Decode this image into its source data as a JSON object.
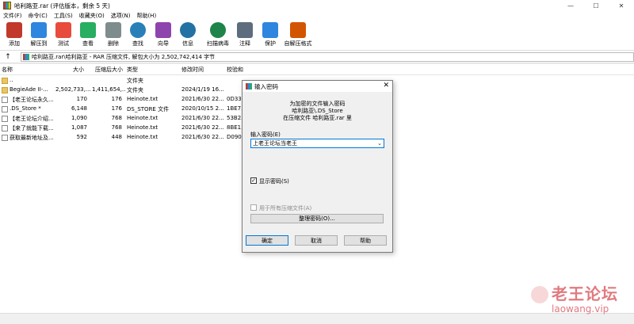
{
  "window": {
    "title": "哈利路亚.rar (评估版本，剩余 5 天)",
    "controls": [
      "—",
      "☐",
      "✕"
    ]
  },
  "menu": [
    "文件(F)",
    "命令(C)",
    "工具(S)",
    "收藏夹(O)",
    "选项(N)",
    "帮助(H)"
  ],
  "toolbar": [
    {
      "label": "添加",
      "icon": "add-archive-icon",
      "color": "#c0392b"
    },
    {
      "label": "解压到",
      "icon": "extract-to-icon",
      "color": "#2e86de"
    },
    {
      "label": "测试",
      "icon": "test-icon",
      "color": "#e74c3c"
    },
    {
      "label": "查看",
      "icon": "view-icon",
      "color": "#27ae60"
    },
    {
      "label": "删除",
      "icon": "delete-icon",
      "color": "#7f8c8d"
    },
    {
      "label": "查找",
      "icon": "find-icon",
      "color": "#2980b9"
    },
    {
      "label": "向导",
      "icon": "wizard-icon",
      "color": "#8e44ad"
    },
    {
      "label": "信息",
      "icon": "info-icon",
      "color": "#2471a3"
    },
    {
      "label": "扫描病毒",
      "icon": "virus-scan-icon",
      "color": "#1e8449"
    },
    {
      "label": "注释",
      "icon": "comment-icon",
      "color": "#5d6d7e"
    },
    {
      "label": "保护",
      "icon": "protect-icon",
      "color": "#2e86de"
    },
    {
      "label": "自解压格式",
      "icon": "sfx-icon",
      "color": "#d35400"
    }
  ],
  "address": {
    "up_glyph": "↑",
    "path": "哈利路亚.rar\\哈利路亚 - RAR 压缩文件, 解包大小为 2,502,742,414 字节"
  },
  "columns": [
    "名称",
    "大小",
    "压缩后大小",
    "类型",
    "修改时间",
    "校验和"
  ],
  "files": [
    {
      "name": "..",
      "size": "",
      "packed": "",
      "type": "文件夹",
      "modified": "",
      "crc": "",
      "kind": "folder"
    },
    {
      "name": "BegieAde II-...",
      "size": "2,502,733,...",
      "packed": "1,411,654,...",
      "type": "文件夹",
      "modified": "2024/1/19 16...",
      "crc": "",
      "kind": "folder"
    },
    {
      "name": "【老王论坛永久...",
      "size": "170",
      "packed": "176",
      "type": "Heinote.txt",
      "modified": "2021/6/30 22...",
      "crc": "0D33...",
      "kind": "txt"
    },
    {
      "name": ".DS_Store *",
      "size": "6,148",
      "packed": "176",
      "type": "DS_STORE 文件",
      "modified": "2020/10/15 2...",
      "crc": "1BE7...",
      "kind": "txt"
    },
    {
      "name": "【老王论坛介绍...",
      "size": "1,090",
      "packed": "768",
      "type": "Heinote.txt",
      "modified": "2021/6/30 22...",
      "crc": "53B2...",
      "kind": "txt"
    },
    {
      "name": "【来了就能下载...",
      "size": "1,087",
      "packed": "768",
      "type": "Heinote.txt",
      "modified": "2021/6/30 22...",
      "crc": "8BE1...",
      "kind": "txt"
    },
    {
      "name": "获取最新地址及...",
      "size": "592",
      "packed": "448",
      "type": "Heinote.txt",
      "modified": "2021/6/30 22...",
      "crc": "D090...",
      "kind": "txt"
    }
  ],
  "dialog": {
    "title": "输入密码",
    "close_glyph": "✕",
    "line1": "为加密的文件输入密码",
    "line2": "哈利路亚\\.DS_Store",
    "line3": "在压缩文件 哈利路亚.rar 里",
    "password_label": "输入密码(E)",
    "password_value": "上老王论坛当老王",
    "dropdown_glyph": "⌄",
    "show_password_label": "显示密码(S)",
    "show_password_checked": "✓",
    "use_all_label": "用于所有压缩文件(A)",
    "manage_label": "整理密码(O)...",
    "ok_label": "确定",
    "cancel_label": "取消",
    "help_label": "帮助"
  },
  "watermark": {
    "main": "老王论坛",
    "sub": "laowang.vip"
  }
}
